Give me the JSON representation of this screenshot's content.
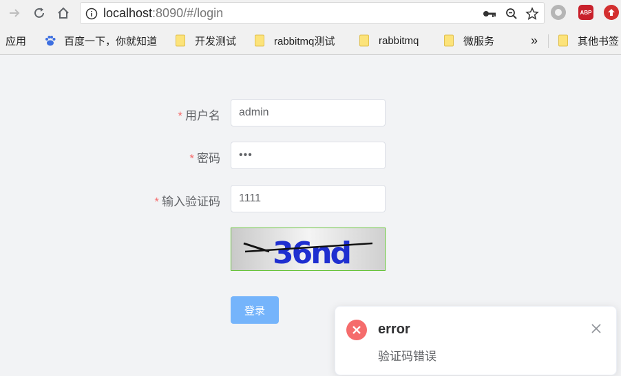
{
  "browser": {
    "url_host": "localhost",
    "url_rest": ":8090/#/login",
    "bookmarks": {
      "apps": "应用",
      "baidu": "百度一下，你就知道",
      "dev_test": "开发测试",
      "rabbitmq_test": "rabbitmq测试",
      "rabbitmq": "rabbitmq",
      "microservice": "微服务",
      "more": "»",
      "other": "其他书签"
    },
    "extensions": {
      "abp": "ABP"
    }
  },
  "form": {
    "required_mark": "*",
    "username_label": "用户名",
    "username_value": "admin",
    "password_label": "密码",
    "password_value": "•••",
    "captcha_label": "输入验证码",
    "captcha_value": "1111",
    "captcha_image_text": "36nd",
    "login_label": "登录"
  },
  "notification": {
    "title": "error",
    "message": "验证码错误"
  },
  "colors": {
    "required": "#f56c6c",
    "primary_button": "#75b4fb",
    "error": "#f56c6c",
    "captcha_border": "#67c23a"
  }
}
